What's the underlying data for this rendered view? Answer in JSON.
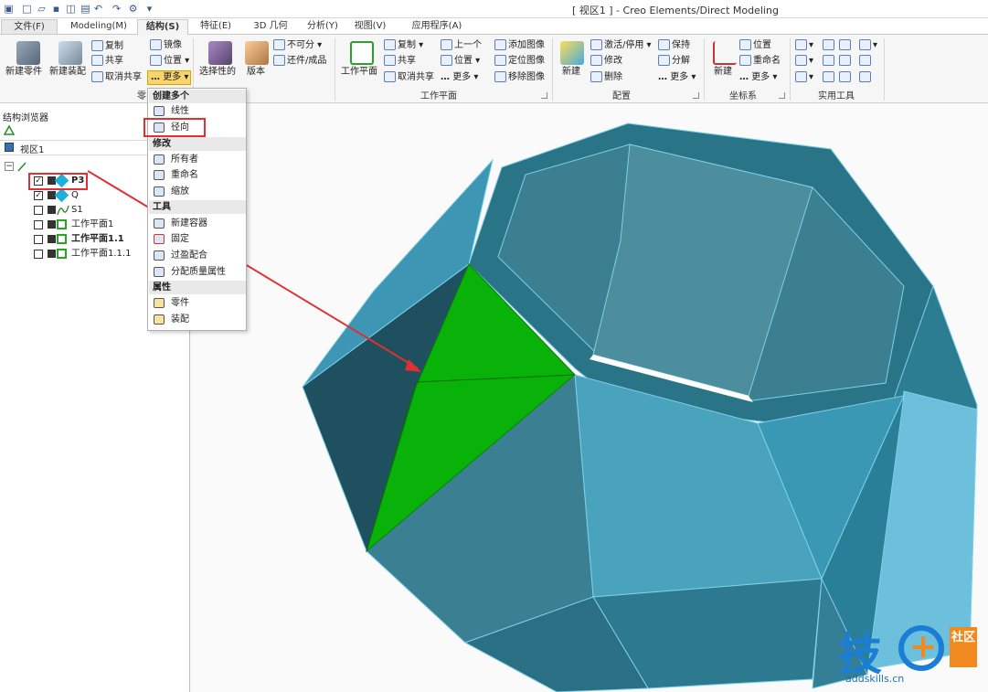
{
  "window": {
    "title": "[ 视区1 ] - Creo Elements/Direct Modeling"
  },
  "tabs": [
    {
      "label": "文件(F)"
    },
    {
      "label": "Modeling(M)"
    },
    {
      "label": "结构(S)"
    },
    {
      "label": "特征(E)"
    },
    {
      "label": "3D 几何"
    },
    {
      "label": "分析(Y)"
    },
    {
      "label": "视图(V)"
    },
    {
      "label": "应用程序(A)"
    }
  ],
  "ribbon": {
    "new_part": "新建零件",
    "new_assembly": "新建装配",
    "copy": "复制",
    "share": "共享",
    "unshare": "取消共享",
    "mirror": "镜像",
    "position": "位置",
    "more": "更多",
    "optional": "选择性的",
    "version": "版本",
    "inseparable": "不可分",
    "restore": "还件/成品",
    "workplane": "工作平面",
    "wp_copy": "复制",
    "wp_share": "共享",
    "wp_unshare": "取消共享",
    "wp_prev": "上一个",
    "wp_position": "位置",
    "wp_more": "更多",
    "add_image": "添加图像",
    "position_image": "定位图像",
    "remove_image": "移除图像",
    "cfg_new": "新建",
    "activate": "激活/停用",
    "modify": "修改",
    "delete": "删除",
    "keep": "保持",
    "decompose": "分解",
    "cfg_more": "更多",
    "cs_new": "新建",
    "cs_position": "位置",
    "cs_rename": "重命名",
    "cs_more": "更多",
    "group_parts": "零",
    "group_workplane": "工作平面",
    "group_config": "配置",
    "group_coords": "坐标系",
    "group_tools": "实用工具"
  },
  "browser": {
    "title": "结构浏览器",
    "viewport": "视区1",
    "items": [
      {
        "label": "P3",
        "checked": true,
        "bold": true
      },
      {
        "label": "Q",
        "checked": true,
        "bold": false
      },
      {
        "label": "S1",
        "checked": false,
        "bold": false
      },
      {
        "label": "工作平面1",
        "checked": false,
        "bold": false
      },
      {
        "label": "工作平面1.1",
        "checked": false,
        "bold": true
      },
      {
        "label": "工作平面1.1.1",
        "checked": false,
        "bold": false
      }
    ]
  },
  "dropdown": {
    "section_create": "创建多个",
    "linear": "线性",
    "radial": "径向",
    "section_modify": "修改",
    "owner": "所有者",
    "rename": "重命名",
    "scale": "缩放",
    "section_tools": "工具",
    "new_container": "新建容器",
    "fix": "固定",
    "interference": "过盈配合",
    "mass_props": "分配质量属性",
    "section_props": "属性",
    "part": "零件",
    "assembly": "装配"
  },
  "watermark": {
    "brand_char": "技",
    "badge": "社区",
    "url": "addskills.cn"
  },
  "colors": {
    "highlight_face": "#08b208",
    "model_dark": "#1e5060",
    "model_mid": "#3c8aa0",
    "model_light": "#68bedc",
    "annotation_red": "#e03030",
    "watermark_blue": "#1a7fd4",
    "watermark_orange": "#f08a1e"
  }
}
